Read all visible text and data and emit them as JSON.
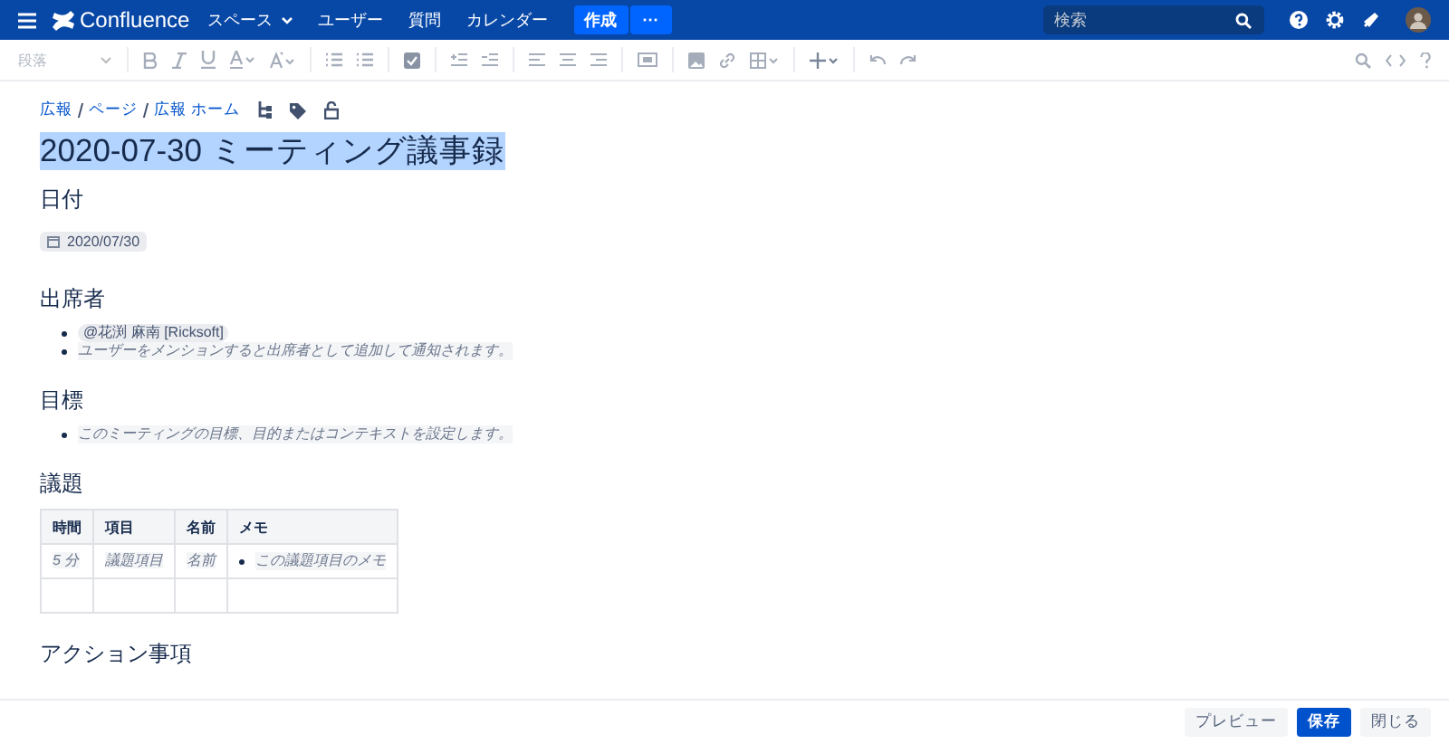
{
  "nav": {
    "product": "Confluence",
    "items": [
      {
        "label": "スペース",
        "dropdown": true
      },
      {
        "label": "ユーザー",
        "dropdown": false
      },
      {
        "label": "質問",
        "dropdown": false
      },
      {
        "label": "カレンダー",
        "dropdown": false
      }
    ],
    "create": "作成",
    "more": "···",
    "search": {
      "placeholder": "検索"
    }
  },
  "toolbar": {
    "paragraph": "段落"
  },
  "breadcrumb": [
    "広報",
    "ページ",
    "広報 ホーム"
  ],
  "title": "2020-07-30 ミーティング議事録",
  "sections": [
    {
      "heading": "日付",
      "kind": "date",
      "date": "2020/07/30"
    },
    {
      "heading": "出席者",
      "kind": "list",
      "items": [
        {
          "text": "@花渕 麻南 [Ricksoft]",
          "kind": "mention"
        },
        {
          "text": "ユーザーをメンションすると出席者として追加して通知されます。",
          "kind": "hint"
        }
      ]
    },
    {
      "heading": "目標",
      "kind": "list",
      "items": [
        {
          "text": "このミーティングの目標、目的またはコンテキストを設定します。",
          "kind": "hint"
        }
      ]
    },
    {
      "heading": "議題",
      "kind": "table",
      "columns": [
        "時間",
        "項目",
        "名前",
        "メモ"
      ],
      "rows": [
        [
          "5 分",
          "議題項目",
          "名前",
          "この議題項目のメモ"
        ],
        [
          "",
          "",
          "",
          ""
        ]
      ]
    },
    {
      "heading": "アクション事項",
      "kind": "heading"
    }
  ],
  "footer": {
    "buttons": [
      {
        "label": "プレビュー",
        "kind": "secondary"
      },
      {
        "label": "保存",
        "kind": "primary"
      },
      {
        "label": "閉じる",
        "kind": "secondary"
      }
    ]
  }
}
